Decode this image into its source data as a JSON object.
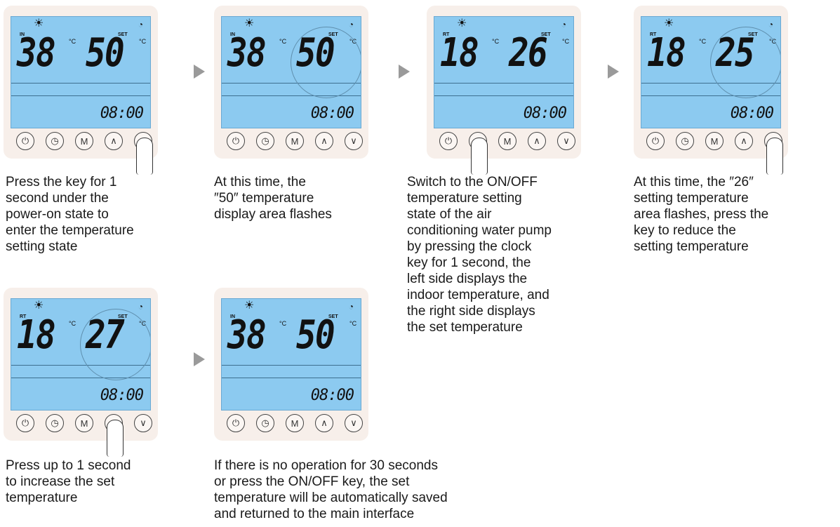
{
  "panels": [
    {
      "lcd_label_left": "IN",
      "left_value": "38",
      "set_label": "SET",
      "right_value": "50",
      "time": "08:00",
      "flash": false,
      "deg": "°C"
    },
    {
      "lcd_label_left": "IN",
      "left_value": "38",
      "set_label": "SET",
      "right_value": "50",
      "time": "08:00",
      "flash": true,
      "deg": "°C"
    },
    {
      "lcd_label_left": "RT",
      "left_value": "18",
      "set_label": "SET",
      "right_value": "26",
      "time": "08:00",
      "flash": false,
      "deg": "°C"
    },
    {
      "lcd_label_left": "RT",
      "left_value": "18",
      "set_label": "SET",
      "right_value": "25",
      "time": "08:00",
      "flash": true,
      "deg": "°C"
    },
    {
      "lcd_label_left": "RT",
      "left_value": "18",
      "set_label": "SET",
      "right_value": "27",
      "time": "08:00",
      "flash": true,
      "deg": "°C"
    },
    {
      "lcd_label_left": "IN",
      "left_value": "38",
      "set_label": "SET",
      "right_value": "50",
      "time": "08:00",
      "flash": false,
      "deg": "°C"
    }
  ],
  "keys": {
    "power": "power-key",
    "clock": "clock-key",
    "mode": "M",
    "up": "up-key",
    "down": "down-key"
  },
  "captions": [
    "Press the key for 1\nsecond under the\npower-on state to\nenter the temperature\nsetting state",
    "At this time, the\n″50″ temperature\ndisplay area flashes",
    "Switch to the ON/OFF\ntemperature setting\nstate of the air\nconditioning water pump\nby pressing the clock\nkey for 1 second, the\nleft side displays the\nindoor temperature, and\nthe right side displays\nthe set temperature",
    "At this time, the ″26″\nsetting temperature\narea flashes, press the\nkey to reduce the\nsetting temperature",
    "Press up to 1 second\nto increase the set\ntemperature",
    "If there is no operation for 30 seconds\nor press the ON/OFF key, the set\ntemperature will be automatically saved\nand returned to the main interface"
  ],
  "colors": {
    "lcd": "#8ccaf0",
    "panel": "#f7efea",
    "arrow": "#9a9a9a"
  }
}
